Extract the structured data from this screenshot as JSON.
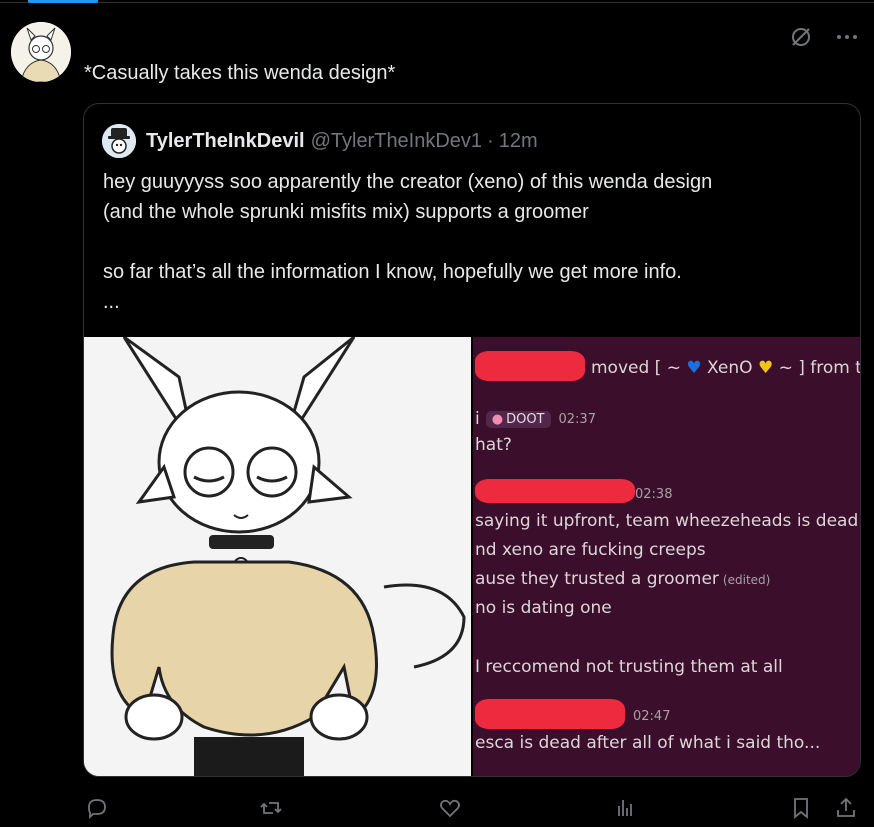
{
  "post": {
    "text": "*Casually takes this wenda design*",
    "grok_icon": "grok-icon",
    "more_icon": "more-icon"
  },
  "quote": {
    "display_name": "TylerTheInkDevil",
    "handle": "@TylerTheInkDev1",
    "separator": "·",
    "time": "12m",
    "body": [
      "hey guuyyyss soo apparently the creator (xeno) of this wenda design",
      "(and the whole sprunki misfits mix) supports a groomer",
      "",
      "so far that’s all the information I know, hopefully we get more info.",
      "..."
    ]
  },
  "screenshot_right": {
    "line_system_a": "moved [ ~",
    "line_system_name": "XenO",
    "line_system_b": "~ ] from the",
    "msg1_name_tail": "i",
    "msg1_badge": "DOOT",
    "msg1_time": "02:37",
    "msg1_text": "hat?",
    "msg2_time": "02:38",
    "msg2_lines": [
      "saying it upfront, team wheezeheads is dead",
      "nd xeno are fucking creeps",
      "ause they trusted a groomer",
      "no is dating one",
      "",
      "I reccomend not trusting them at all"
    ],
    "msg2_edited": "(edited)",
    "msg3_time": "02:47",
    "msg3_text": "esca is dead after all of what i said tho..."
  },
  "actions": {
    "reply_icon": "reply-icon",
    "repost_icon": "repost-icon",
    "like_icon": "like-icon",
    "views_icon": "views-icon",
    "bookmark_icon": "bookmark-icon",
    "share_icon": "share-icon"
  },
  "colors": {
    "background": "#000000",
    "text": "#e7e9ea",
    "muted": "#71767b",
    "border": "#2f3336",
    "accent": "#1d9bf0",
    "discord_bg": "#3b0f2b",
    "redaction": "#ee2a3f"
  }
}
